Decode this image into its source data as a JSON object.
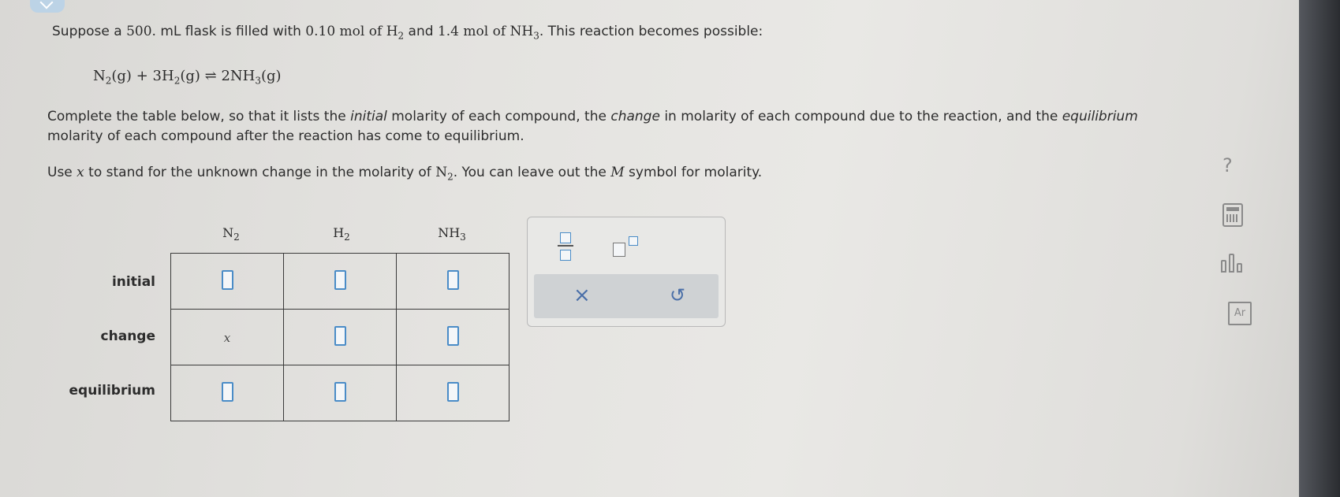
{
  "intro": {
    "t1": "Suppose a ",
    "volume": "500.",
    "t2": " mL flask is filled with ",
    "h2_amount": "0.10",
    "t3": " mol of ",
    "t4": " and ",
    "nh3_amount": "1.4",
    "t5": " mol of ",
    "t6": ". This reaction becomes possible:"
  },
  "equation": {
    "n2": "N",
    "g": "(g)",
    "plus": "+",
    "h2_coef": "3",
    "h": "H",
    "arrow": "⇌",
    "nh3_coef": "2",
    "nh": "NH",
    "sub2": "2",
    "sub3": "3"
  },
  "instructions": {
    "a": "Complete the table below, so that it lists the ",
    "initial_word": "initial",
    "b": " molarity of each compound, the ",
    "change_word": "change",
    "c": " in molarity of each compound due to the reaction, and the ",
    "equilibrium_word": "equilibrium",
    "d": " molarity of each compound after the reaction has come to equilibrium."
  },
  "hint": {
    "a": "Use ",
    "x": "x",
    "b": " to stand for the unknown change in the molarity of ",
    "c": ". You can leave out the ",
    "m": "M",
    "d": " symbol for molarity."
  },
  "table": {
    "columns": [
      "N2",
      "H2",
      "NH3"
    ],
    "rows": [
      "initial",
      "change",
      "equilibrium"
    ],
    "change_n2_value": "x"
  },
  "panel": {
    "clear_symbol": "×",
    "undo_symbol": "↺"
  },
  "sidebar": {
    "help_symbol": "?",
    "periodic_label": "Ar"
  },
  "colors": {
    "accent": "#4a8cc7",
    "panel_bar": "#cfd2d4"
  }
}
